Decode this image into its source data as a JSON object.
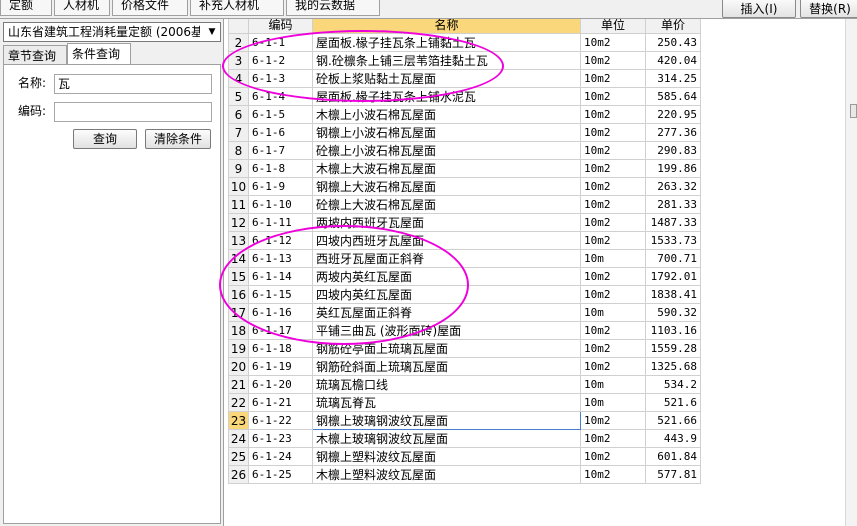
{
  "top_tabs": [
    "定额",
    "人材机",
    "价格文件",
    "补充人材机",
    "我的云数据"
  ],
  "top_buttons": {
    "insert": "插入(I)",
    "replace": "替换(R)"
  },
  "left": {
    "library": "山东省建筑工程消耗量定额 (2006基价)",
    "tabs": [
      "章节查询",
      "条件查询"
    ],
    "name_label": "名称:",
    "name_value": "瓦",
    "code_label": "编码:",
    "code_value": "",
    "query_button": "查询",
    "clear_button": "清除条件"
  },
  "grid": {
    "headers": [
      "编码",
      "名称",
      "单位",
      "单价"
    ],
    "selected_row": "23",
    "rows": [
      {
        "no": "2",
        "code": "6-1-1",
        "name": "屋面板.椽子挂瓦条上铺黏土瓦",
        "unit": "10m2",
        "price": "250.43"
      },
      {
        "no": "3",
        "code": "6-1-2",
        "name": "钢.砼檩条上铺三层苇箔挂黏土瓦",
        "unit": "10m2",
        "price": "420.04"
      },
      {
        "no": "4",
        "code": "6-1-3",
        "name": "砼板上浆贴黏土瓦屋面",
        "unit": "10m2",
        "price": "314.25"
      },
      {
        "no": "5",
        "code": "6-1-4",
        "name": "屋面板.椽子挂瓦条上铺水泥瓦",
        "unit": "10m2",
        "price": "585.64"
      },
      {
        "no": "6",
        "code": "6-1-5",
        "name": "木檩上小波石棉瓦屋面",
        "unit": "10m2",
        "price": "220.95"
      },
      {
        "no": "7",
        "code": "6-1-6",
        "name": "钢檩上小波石棉瓦屋面",
        "unit": "10m2",
        "price": "277.36"
      },
      {
        "no": "8",
        "code": "6-1-7",
        "name": "砼檩上小波石棉瓦屋面",
        "unit": "10m2",
        "price": "290.83"
      },
      {
        "no": "9",
        "code": "6-1-8",
        "name": "木檩上大波石棉瓦屋面",
        "unit": "10m2",
        "price": "199.86"
      },
      {
        "no": "10",
        "code": "6-1-9",
        "name": "钢檩上大波石棉瓦屋面",
        "unit": "10m2",
        "price": "263.32"
      },
      {
        "no": "11",
        "code": "6-1-10",
        "name": "砼檩上大波石棉瓦屋面",
        "unit": "10m2",
        "price": "281.33"
      },
      {
        "no": "12",
        "code": "6-1-11",
        "name": "两坡内西班牙瓦屋面",
        "unit": "10m2",
        "price": "1487.33"
      },
      {
        "no": "13",
        "code": "6-1-12",
        "name": "四坡内西班牙瓦屋面",
        "unit": "10m2",
        "price": "1533.73"
      },
      {
        "no": "14",
        "code": "6-1-13",
        "name": "西班牙瓦屋面正斜脊",
        "unit": "10m",
        "price": "700.71"
      },
      {
        "no": "15",
        "code": "6-1-14",
        "name": "两坡内英红瓦屋面",
        "unit": "10m2",
        "price": "1792.01"
      },
      {
        "no": "16",
        "code": "6-1-15",
        "name": "四坡内英红瓦屋面",
        "unit": "10m2",
        "price": "1838.41"
      },
      {
        "no": "17",
        "code": "6-1-16",
        "name": "英红瓦屋面正斜脊",
        "unit": "10m",
        "price": "590.32"
      },
      {
        "no": "18",
        "code": "6-1-17",
        "name": "平铺三曲瓦 (波形面砖)屋面",
        "unit": "10m2",
        "price": "1103.16"
      },
      {
        "no": "19",
        "code": "6-1-18",
        "name": "钢筋砼亭面上琉璃瓦屋面",
        "unit": "10m2",
        "price": "1559.28"
      },
      {
        "no": "20",
        "code": "6-1-19",
        "name": "钢筋砼斜面上琉璃瓦屋面",
        "unit": "10m2",
        "price": "1325.68"
      },
      {
        "no": "21",
        "code": "6-1-20",
        "name": "琉璃瓦檐口线",
        "unit": "10m",
        "price": "534.2"
      },
      {
        "no": "22",
        "code": "6-1-21",
        "name": "琉璃瓦脊瓦",
        "unit": "10m",
        "price": "521.6"
      },
      {
        "no": "23",
        "code": "6-1-22",
        "name": "钢檩上玻璃钢波纹瓦屋面",
        "unit": "10m2",
        "price": "521.66"
      },
      {
        "no": "24",
        "code": "6-1-23",
        "name": "木檩上玻璃钢波纹瓦屋面",
        "unit": "10m2",
        "price": "443.9"
      },
      {
        "no": "25",
        "code": "6-1-24",
        "name": "钢檩上塑料波纹瓦屋面",
        "unit": "10m2",
        "price": "601.84"
      },
      {
        "no": "26",
        "code": "6-1-25",
        "name": "木檩上塑料波纹瓦屋面",
        "unit": "10m2",
        "price": "577.81"
      }
    ]
  },
  "colors": {
    "highlight_ellipse": "#ee00dd",
    "header_accent": "#f9d77a",
    "selected_border": "#4a7fd0"
  }
}
